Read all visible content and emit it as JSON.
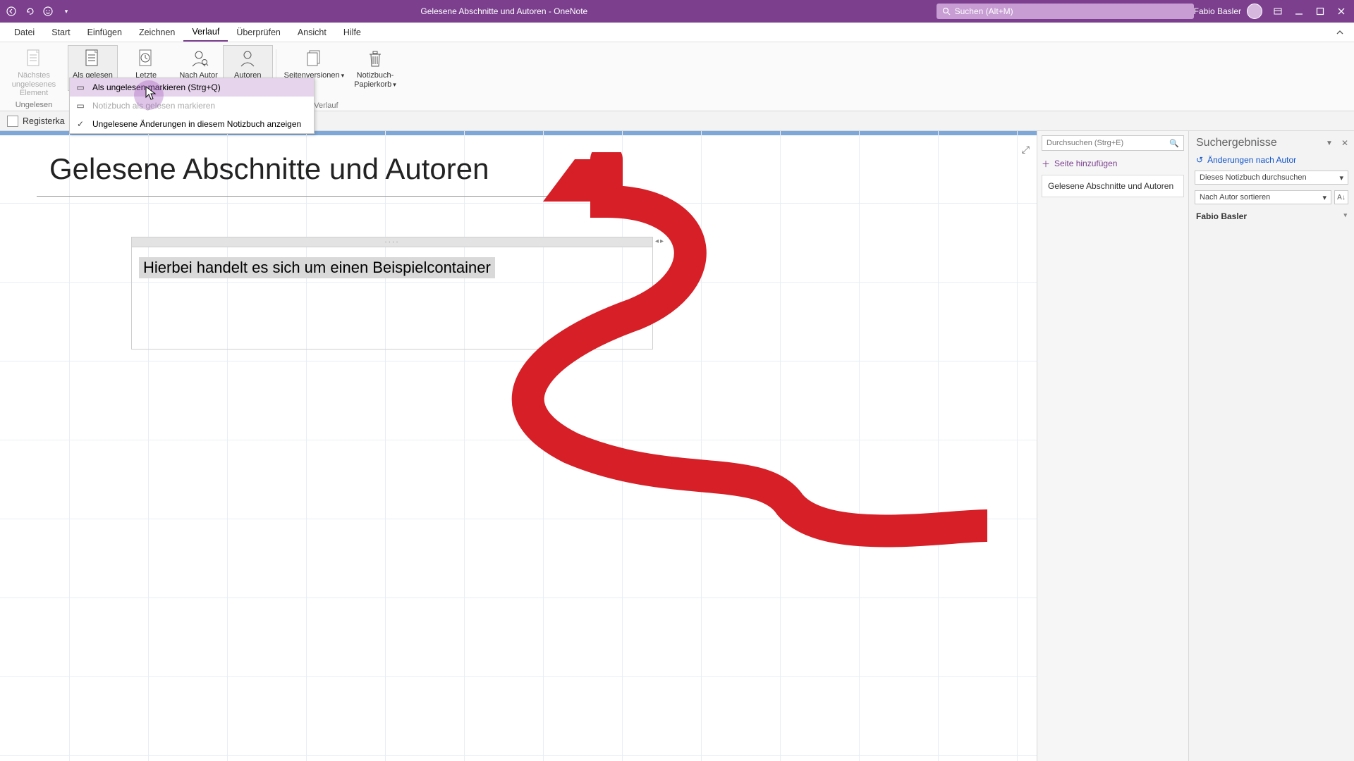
{
  "titlebar": {
    "doc_title": "Gelesene Abschnitte und Autoren  -  OneNote",
    "search_placeholder": "Suchen (Alt+M)",
    "user_name": "Fabio Basler"
  },
  "menu": {
    "tabs": [
      "Datei",
      "Start",
      "Einfügen",
      "Zeichnen",
      "Verlauf",
      "Überprüfen",
      "Ansicht",
      "Hilfe"
    ],
    "active_index": 4
  },
  "ribbon": {
    "items": [
      {
        "label": "Nächstes\nungelesenes Element",
        "disabled": true
      },
      {
        "label": "Als gelesen\nmarkieren",
        "dropdown": true,
        "active": true
      },
      {
        "label": "Letzte\nÄnderungen",
        "dropdown": true
      },
      {
        "label": "Nach Autor\nsuchen"
      },
      {
        "label": "Autoren\nausblenden",
        "active": true
      },
      {
        "label": "Seitenversionen",
        "dropdown": true
      },
      {
        "label": "Notizbuch-\nPapierkorb",
        "dropdown": true
      }
    ],
    "group_left": "Ungelesen",
    "group_right": "Verlauf"
  },
  "dropdown": {
    "items": [
      {
        "label": "Als ungelesen markieren (Strg+Q)",
        "hover": true,
        "icon": true
      },
      {
        "label": "Notizbuch als gelesen markieren",
        "disabled": true,
        "icon": true
      },
      {
        "label": "Ungelesene Änderungen in diesem Notizbuch anzeigen",
        "checked": true
      }
    ]
  },
  "section_row": {
    "label": "Registerka"
  },
  "page": {
    "title": "Gelesene Abschnitte und Autoren",
    "container_text": "Hierbei handelt es sich um einen Beispielcontainer"
  },
  "pagepane": {
    "search_placeholder": "Durchsuchen (Strg+E)",
    "add_label": "Seite hinzufügen",
    "page_item": "Gelesene Abschnitte und Autoren"
  },
  "searchpane": {
    "title": "Suchergebnisse",
    "link": "Änderungen nach Autor",
    "scope": "Dieses Notizbuch durchsuchen",
    "sort": "Nach Autor sortieren",
    "author": "Fabio Basler"
  }
}
